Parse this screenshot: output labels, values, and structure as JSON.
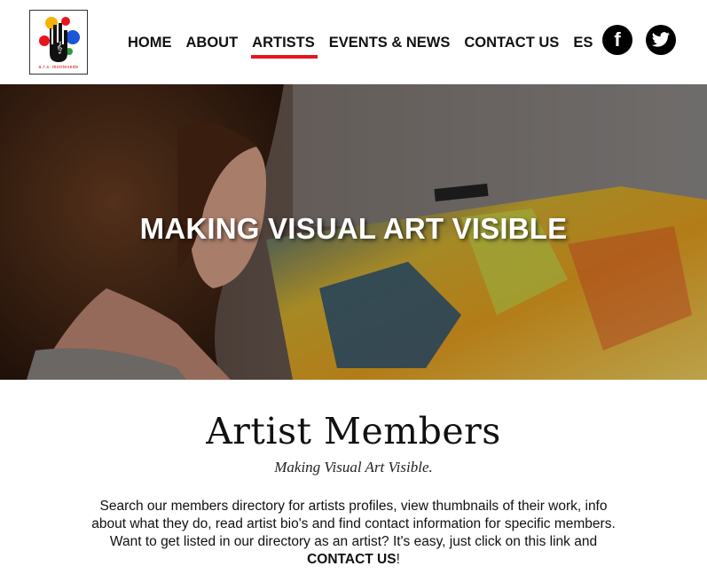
{
  "header": {
    "logo_text": "a.r.s. montevede",
    "nav": [
      {
        "label": "HOME",
        "active": false
      },
      {
        "label": "ABOUT",
        "active": false
      },
      {
        "label": "ARTISTS",
        "active": true
      },
      {
        "label": "EVENTS & NEWS",
        "active": false
      },
      {
        "label": "CONTACT US",
        "active": false
      },
      {
        "label": "ES",
        "active": false
      }
    ],
    "social": [
      {
        "icon": "facebook-icon",
        "glyph": "f"
      },
      {
        "icon": "twitter-icon"
      }
    ],
    "accent_color": "#e8141c"
  },
  "hero": {
    "title": "MAKING VISUAL ART VISIBLE"
  },
  "main": {
    "title": "Artist Members",
    "subtitle": "Making Visual Art Visible.",
    "intro_lines": [
      "Search our members directory for artists profiles, view thumbnails of their work, info",
      "about what they do, read artist bio's and find contact information for specific members.",
      "Want to get listed in our directory as an artist? It's easy, just click on this link and"
    ],
    "contact_link": "CONTACT US",
    "contact_suffix": "!"
  }
}
